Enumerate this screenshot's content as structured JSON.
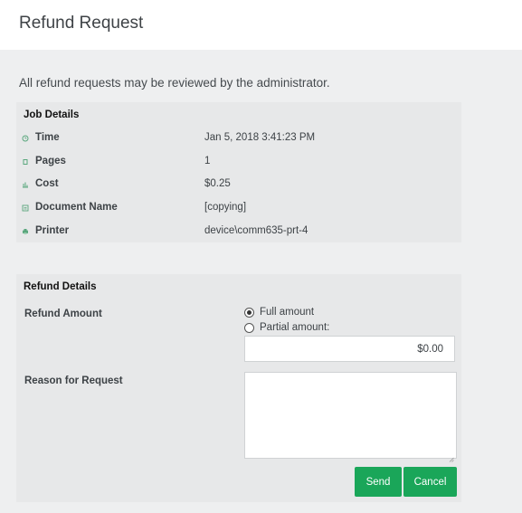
{
  "header": {
    "title": "Refund Request"
  },
  "intro": "All refund requests may be reviewed by the administrator.",
  "job_details": {
    "title": "Job Details",
    "rows": [
      {
        "label": "Time",
        "value": "Jan 5, 2018 3:41:23 PM",
        "icon": "clock-icon"
      },
      {
        "label": "Pages",
        "value": "1",
        "icon": "pages-icon"
      },
      {
        "label": "Cost",
        "value": "$0.25",
        "icon": "cost-icon"
      },
      {
        "label": "Document Name",
        "value": "[copying]",
        "icon": "document-icon"
      },
      {
        "label": "Printer",
        "value": "device\\comm635-prt-4",
        "icon": "printer-icon"
      }
    ]
  },
  "refund_details": {
    "title": "Refund Details",
    "amount_label": "Refund Amount",
    "full_amount": "Full amount",
    "partial_amount": "Partial amount:",
    "selected": "full",
    "amount_value": "$0.00",
    "reason_label": "Reason for Request",
    "reason_value": ""
  },
  "buttons": {
    "send": "Send",
    "cancel": "Cancel"
  },
  "colors": {
    "accent": "#1aa659",
    "icon": "#5aa77d"
  }
}
